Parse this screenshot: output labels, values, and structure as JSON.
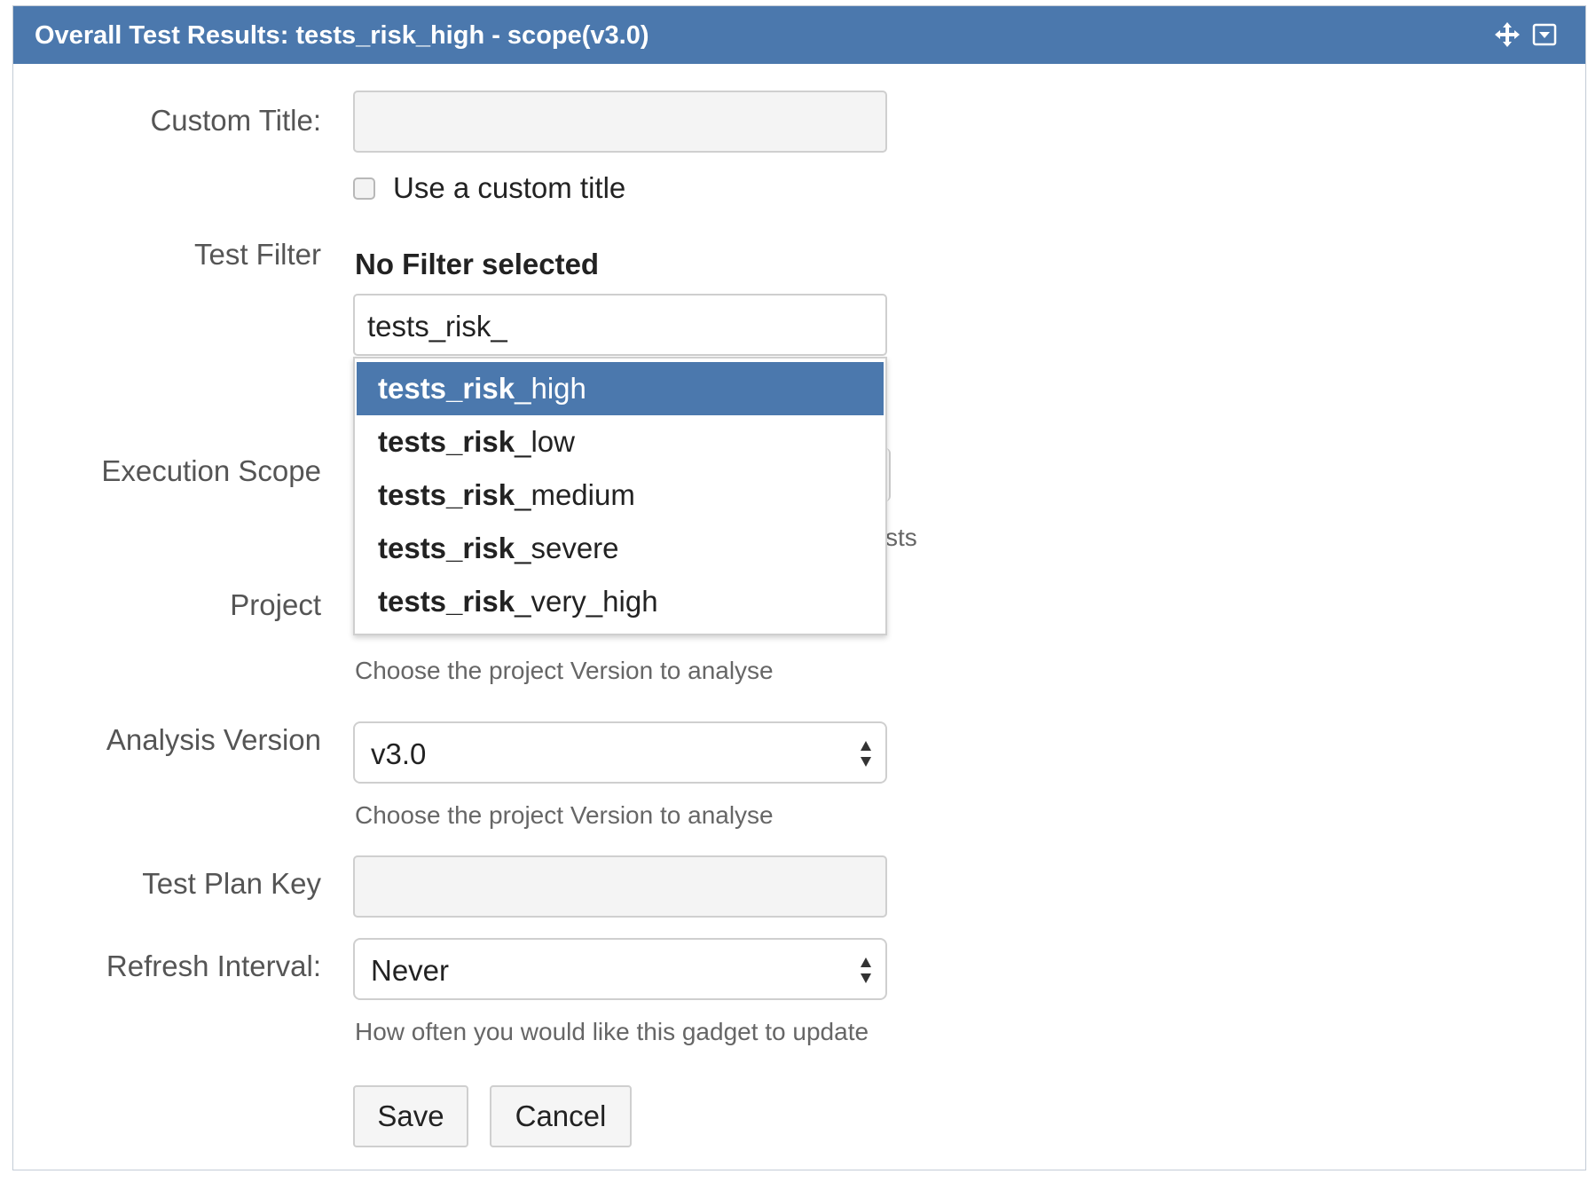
{
  "header": {
    "title": "Overall Test Results: tests_risk_high - scope(v3.0)",
    "icons": [
      "move-icon",
      "menu-dropdown-icon"
    ],
    "bg_color": "#4b78ad"
  },
  "form": {
    "custom_title": {
      "label": "Custom Title:",
      "value": "",
      "checkbox_label": "Use a custom title",
      "checked": false
    },
    "test_filter": {
      "label": "Test Filter",
      "status": "No Filter selected",
      "input_value": "tests_risk_",
      "suggestions": [
        {
          "match": "tests_risk",
          "rest": "_high",
          "selected": true
        },
        {
          "match": "tests_risk",
          "rest": "_low",
          "selected": false
        },
        {
          "match": "tests_risk",
          "rest": "_medium",
          "selected": false
        },
        {
          "match": "tests_risk",
          "rest": "_severe",
          "selected": false
        },
        {
          "match": "tests_risk",
          "rest": "_very_high",
          "selected": false
        }
      ],
      "hidden_hint_fragment": "sts"
    },
    "execution_scope": {
      "label": "Execution Scope"
    },
    "project": {
      "label": "Project",
      "hint": "Choose the project Version to analyse"
    },
    "analysis_version": {
      "label": "Analysis Version",
      "value": "v3.0",
      "hint": "Choose the project Version to analyse"
    },
    "test_plan_key": {
      "label": "Test Plan Key",
      "value": ""
    },
    "refresh_interval": {
      "label": "Refresh Interval:",
      "value": "Never",
      "hint": "How often you would like this gadget to update"
    }
  },
  "buttons": {
    "save": "Save",
    "cancel": "Cancel"
  }
}
